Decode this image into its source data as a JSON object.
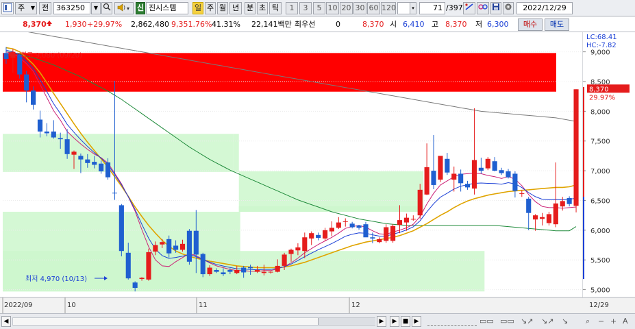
{
  "toolbar": {
    "market_selector": "주",
    "prev_label": "전",
    "stock_code": "363250",
    "stock_name_badge": "신",
    "stock_name": "진시스템",
    "day_btn": "일",
    "week_btn": "주",
    "month_btn": "월",
    "year_btn": "년",
    "min_btn": "분",
    "sec_btn": "초",
    "tick_btn": "틱",
    "periods": [
      "1",
      "3",
      "5",
      "10",
      "20",
      "30",
      "60",
      "120"
    ],
    "page_counter": "71",
    "page_total": "/397",
    "date": "2022/12/29"
  },
  "quote": {
    "price": "8,370",
    "change": "1,930",
    "change_pct": "+29.97%",
    "volume": "2,862,480",
    "volume_ratio": "9,351.76%",
    "turnover_ratio": "41.31%",
    "amount": "22,141백만",
    "trader": "최우선",
    "trader_val": "0",
    "last": "8,370",
    "open_label": "시",
    "open": "6,410",
    "high_label": "고",
    "high": "8,370",
    "low_label": "저",
    "low": "6,300",
    "buy_label": "매수",
    "sell_label": "매도"
  },
  "chart_labels": {
    "lc": "LC:68.41",
    "hc": "HC:-7.82",
    "last_price_tag": "8,370",
    "last_pct_tag": "29.97%",
    "high_marker": "최고 9,080 (09/20)",
    "low_marker": "최저 4,970 (10/13)"
  },
  "chart_data": {
    "type": "candlestick",
    "y_ticks": [
      "9,000",
      "8,500",
      "8,000",
      "7,500",
      "7,000",
      "6,500",
      "6,000",
      "5,500",
      "5,000"
    ],
    "y_tick_values": [
      9000,
      8500,
      8000,
      7500,
      7000,
      6500,
      6000,
      5500,
      5000
    ],
    "ylim": [
      4880,
      9330
    ],
    "x_labels": [
      "2022/09",
      "10",
      "11",
      "12",
      "12/29"
    ],
    "candles": [
      {
        "o": 8980,
        "h": 9080,
        "l": 8800,
        "c": 8880
      },
      {
        "o": 8900,
        "h": 9050,
        "l": 8650,
        "c": 9000
      },
      {
        "o": 8950,
        "h": 8970,
        "l": 8550,
        "c": 8620
      },
      {
        "o": 8620,
        "h": 8680,
        "l": 8150,
        "c": 8350
      },
      {
        "o": 8350,
        "h": 8420,
        "l": 8030,
        "c": 8110
      },
      {
        "o": 7860,
        "h": 8010,
        "l": 7560,
        "c": 7660
      },
      {
        "o": 7660,
        "h": 7800,
        "l": 7580,
        "c": 7630
      },
      {
        "o": 7660,
        "h": 7850,
        "l": 7540,
        "c": 7560
      },
      {
        "o": 7550,
        "h": 7640,
        "l": 7370,
        "c": 7530
      },
      {
        "o": 7530,
        "h": 7700,
        "l": 7200,
        "c": 7280
      },
      {
        "o": 7270,
        "h": 7340,
        "l": 7030,
        "c": 7320
      },
      {
        "o": 7250,
        "h": 7290,
        "l": 6960,
        "c": 7190
      },
      {
        "o": 7190,
        "h": 7280,
        "l": 7050,
        "c": 7130
      },
      {
        "o": 7150,
        "h": 7250,
        "l": 7040,
        "c": 7100
      },
      {
        "o": 7120,
        "h": 7170,
        "l": 6950,
        "c": 6990
      },
      {
        "o": 7140,
        "h": 7210,
        "l": 6850,
        "c": 6890
      },
      {
        "o": 6630,
        "h": 8510,
        "l": 6510,
        "c": 6620
      },
      {
        "o": 6420,
        "h": 6440,
        "l": 5560,
        "c": 5650
      },
      {
        "o": 5620,
        "h": 5790,
        "l": 5170,
        "c": 5190
      },
      {
        "o": 5120,
        "h": 5140,
        "l": 4970,
        "c": 5030
      },
      {
        "o": 5180,
        "h": 5210,
        "l": 5150,
        "c": 5200
      },
      {
        "o": 5170,
        "h": 5690,
        "l": 5150,
        "c": 5630
      },
      {
        "o": 5640,
        "h": 5810,
        "l": 5580,
        "c": 5750
      },
      {
        "o": 5760,
        "h": 5850,
        "l": 5700,
        "c": 5800
      },
      {
        "o": 5850,
        "h": 5910,
        "l": 5540,
        "c": 5610
      },
      {
        "o": 5740,
        "h": 5830,
        "l": 5620,
        "c": 5670
      },
      {
        "o": 5670,
        "h": 5840,
        "l": 5640,
        "c": 5770
      },
      {
        "o": 5990,
        "h": 6020,
        "l": 5420,
        "c": 5470
      },
      {
        "o": 5990,
        "h": 6340,
        "l": 5280,
        "c": 5590
      },
      {
        "o": 5600,
        "h": 5620,
        "l": 5210,
        "c": 5260
      },
      {
        "o": 5260,
        "h": 5410,
        "l": 5230,
        "c": 5370
      },
      {
        "o": 5330,
        "h": 5360,
        "l": 5280,
        "c": 5300
      },
      {
        "o": 5290,
        "h": 5360,
        "l": 5230,
        "c": 5260
      },
      {
        "o": 5330,
        "h": 5360,
        "l": 5260,
        "c": 5300
      },
      {
        "o": 5280,
        "h": 5400,
        "l": 5260,
        "c": 5330
      },
      {
        "o": 5370,
        "h": 5400,
        "l": 5200,
        "c": 5290
      },
      {
        "o": 5380,
        "h": 5420,
        "l": 5250,
        "c": 5360
      },
      {
        "o": 5300,
        "h": 5400,
        "l": 5280,
        "c": 5330
      },
      {
        "o": 5280,
        "h": 5420,
        "l": 5240,
        "c": 5300
      },
      {
        "o": 5290,
        "h": 5310,
        "l": 5270,
        "c": 5300
      },
      {
        "o": 5300,
        "h": 5510,
        "l": 5290,
        "c": 5400
      },
      {
        "o": 5400,
        "h": 5620,
        "l": 5330,
        "c": 5590
      },
      {
        "o": 5600,
        "h": 5690,
        "l": 5470,
        "c": 5670
      },
      {
        "o": 5660,
        "h": 5780,
        "l": 5580,
        "c": 5710
      },
      {
        "o": 5650,
        "h": 5960,
        "l": 5530,
        "c": 5880
      },
      {
        "o": 5860,
        "h": 5980,
        "l": 5750,
        "c": 5950
      },
      {
        "o": 5920,
        "h": 5960,
        "l": 5830,
        "c": 5870
      },
      {
        "o": 5860,
        "h": 6040,
        "l": 5820,
        "c": 6000
      },
      {
        "o": 5980,
        "h": 6150,
        "l": 5900,
        "c": 6040
      },
      {
        "o": 6040,
        "h": 6220,
        "l": 6020,
        "c": 6130
      },
      {
        "o": 6140,
        "h": 6200,
        "l": 6060,
        "c": 6150
      },
      {
        "o": 6110,
        "h": 6140,
        "l": 6030,
        "c": 6050
      },
      {
        "o": 6080,
        "h": 6090,
        "l": 6010,
        "c": 6040
      },
      {
        "o": 6100,
        "h": 6140,
        "l": 5960,
        "c": 5880
      },
      {
        "o": 5880,
        "h": 5960,
        "l": 5780,
        "c": 5860
      },
      {
        "o": 5800,
        "h": 5880,
        "l": 5780,
        "c": 5850
      },
      {
        "o": 5820,
        "h": 6100,
        "l": 5790,
        "c": 6050
      },
      {
        "o": 5820,
        "h": 6100,
        "l": 5790,
        "c": 6070
      },
      {
        "o": 6090,
        "h": 6420,
        "l": 5950,
        "c": 6170
      },
      {
        "o": 6130,
        "h": 6280,
        "l": 5990,
        "c": 6210
      },
      {
        "o": 6190,
        "h": 6250,
        "l": 6160,
        "c": 6190
      },
      {
        "o": 6250,
        "h": 6780,
        "l": 6190,
        "c": 6680
      },
      {
        "o": 6600,
        "h": 7460,
        "l": 6590,
        "c": 7060
      },
      {
        "o": 7000,
        "h": 7600,
        "l": 6690,
        "c": 6760
      },
      {
        "o": 6850,
        "h": 7240,
        "l": 6810,
        "c": 7250
      },
      {
        "o": 7200,
        "h": 7300,
        "l": 6930,
        "c": 6970
      },
      {
        "o": 6850,
        "h": 7070,
        "l": 6650,
        "c": 6950
      },
      {
        "o": 6950,
        "h": 7020,
        "l": 6650,
        "c": 6790
      },
      {
        "o": 6780,
        "h": 6830,
        "l": 6680,
        "c": 6720
      },
      {
        "o": 6700,
        "h": 8050,
        "l": 6600,
        "c": 7180
      },
      {
        "o": 7050,
        "h": 7220,
        "l": 6950,
        "c": 7000
      },
      {
        "o": 7040,
        "h": 7230,
        "l": 7010,
        "c": 7200
      },
      {
        "o": 7160,
        "h": 7230,
        "l": 6990,
        "c": 7000
      },
      {
        "o": 7010,
        "h": 7050,
        "l": 6930,
        "c": 6960
      },
      {
        "o": 6990,
        "h": 7030,
        "l": 6870,
        "c": 6890
      },
      {
        "o": 6950,
        "h": 6990,
        "l": 6550,
        "c": 6660
      },
      {
        "o": 6620,
        "h": 6670,
        "l": 6560,
        "c": 6620
      },
      {
        "o": 6530,
        "h": 6560,
        "l": 6000,
        "c": 6290
      },
      {
        "o": 6180,
        "h": 6270,
        "l": 5990,
        "c": 6250
      },
      {
        "o": 6190,
        "h": 6290,
        "l": 6080,
        "c": 6220
      },
      {
        "o": 6120,
        "h": 6310,
        "l": 6080,
        "c": 6270
      },
      {
        "o": 6100,
        "h": 7140,
        "l": 6050,
        "c": 6450
      },
      {
        "o": 6400,
        "h": 6560,
        "l": 6330,
        "c": 6490
      },
      {
        "o": 6540,
        "h": 6570,
        "l": 6400,
        "c": 6440
      },
      {
        "o": 6410,
        "h": 8370,
        "l": 6300,
        "c": 8370
      }
    ],
    "ma_colors": [
      "#cc2277",
      "#1a3fd6",
      "#e0a400",
      "#1e8a3a",
      "#7a7a7a"
    ],
    "ma5": [
      9000,
      8970,
      8900,
      8800,
      8670,
      8450,
      8230,
      8010,
      7850,
      7660,
      7550,
      7450,
      7360,
      7280,
      7220,
      7130,
      6960,
      6780,
      6560,
      6320,
      6010,
      5720,
      5500,
      5400,
      5390,
      5470,
      5540,
      5610,
      5570,
      5510,
      5450,
      5400,
      5370,
      5340,
      5320,
      5320,
      5310,
      5310,
      5320,
      5320,
      5350,
      5390,
      5450,
      5530,
      5620,
      5690,
      5760,
      5820,
      5880,
      5950,
      6030,
      6060,
      6080,
      6050,
      5990,
      5940,
      5930,
      5970,
      6000,
      6040,
      6100,
      6230,
      6440,
      6620,
      6760,
      6830,
      6900,
      6940,
      6950,
      6960,
      6950,
      6920,
      6900,
      6870,
      6900,
      6860,
      6750,
      6600,
      6480,
      6400,
      6380,
      6380,
      6370,
      6380,
      6390
    ],
    "ma20": [
      9070,
      9050,
      9000,
      8900,
      8790,
      8650,
      8480,
      8300,
      8130,
      7960,
      7790,
      7630,
      7480,
      7340,
      7200,
      7060,
      6900,
      6740,
      6570,
      6390,
      6230,
      6080,
      5950,
      5830,
      5730,
      5650,
      5600,
      5560,
      5530,
      5500,
      5480,
      5460,
      5440,
      5420,
      5400,
      5390,
      5380,
      5370,
      5370,
      5370,
      5370,
      5380,
      5400,
      5430,
      5460,
      5500,
      5540,
      5580,
      5620,
      5660,
      5700,
      5740,
      5770,
      5800,
      5820,
      5840,
      5860,
      5880,
      5910,
      5950,
      5990,
      6050,
      6110,
      6180,
      6250,
      6310,
      6380,
      6440,
      6490,
      6530,
      6560,
      6590,
      6610,
      6630,
      6650,
      6660,
      6670,
      6680,
      6690,
      6700,
      6710,
      6720,
      6720,
      6730,
      6760
    ],
    "ma60": [
      9000,
      8990,
      8960,
      8930,
      8900,
      8860,
      8820,
      8780,
      8730,
      8680,
      8630,
      8580,
      8520,
      8460,
      8400,
      8340,
      8270,
      8200,
      8120,
      8040,
      7960,
      7880,
      7800,
      7720,
      7640,
      7560,
      7480,
      7400,
      7330,
      7260,
      7190,
      7130,
      7070,
      7010,
      6960,
      6910,
      6860,
      6810,
      6760,
      6710,
      6660,
      6610,
      6560,
      6510,
      6470,
      6430,
      6390,
      6350,
      6310,
      6280,
      6250,
      6220,
      6190,
      6170,
      6150,
      6130,
      6110,
      6100,
      6090,
      6080,
      6080,
      6080,
      6080,
      6080,
      6080,
      6080,
      6080,
      6080,
      6080,
      6080,
      6080,
      6080,
      6080,
      6070,
      6060,
      6050,
      6040,
      6030,
      6020,
      6010,
      6000,
      5990,
      5990,
      5990,
      6060
    ],
    "ma120": [
      9400,
      9380,
      9360,
      9340,
      9320,
      9300,
      9280,
      9260,
      9240,
      9220,
      9200,
      9180,
      9160,
      9140,
      9120,
      9100,
      9080,
      9060,
      9040,
      9020,
      9000,
      8980,
      8960,
      8940,
      8920,
      8900,
      8880,
      8860,
      8840,
      8820,
      8800,
      8780,
      8760,
      8740,
      8720,
      8700,
      8680,
      8660,
      8640,
      8620,
      8600,
      8580,
      8560,
      8540,
      8520,
      8500,
      8480,
      8460,
      8440,
      8420,
      8400,
      8380,
      8360,
      8340,
      8320,
      8300,
      8280,
      8260,
      8240,
      8220,
      8200,
      8180,
      8160,
      8140,
      8120,
      8100,
      8080,
      8060,
      8040,
      8020,
      8000,
      7990,
      7980,
      7970,
      7960,
      7950,
      7940,
      7930,
      7920,
      7910,
      7900,
      7890,
      7870,
      7850,
      7830
    ],
    "volume_profile_zones": [
      {
        "x0": 0,
        "x1": 34,
        "y0": 7620,
        "y1": 6980,
        "label": ""
      },
      {
        "x0": 34,
        "x1": 34.8,
        "y0": 7620,
        "y1": 6980,
        "label": ""
      },
      {
        "x0": 34.8,
        "x1": 62,
        "y0": 6990,
        "y1": 6310,
        "label": ""
      },
      {
        "x0": 34.8,
        "x1": 62,
        "y0": 6400,
        "y1": 6310,
        "label": ""
      },
      {
        "x0": 0,
        "x1": 35,
        "y0": 6310,
        "y1": 4970,
        "label": ""
      },
      {
        "x0": 0,
        "x1": 71,
        "y0": 5650,
        "y1": 4970,
        "label": ""
      }
    ],
    "resistance_band": {
      "from": 8330,
      "to": 8980,
      "color": "#ff0000"
    }
  }
}
